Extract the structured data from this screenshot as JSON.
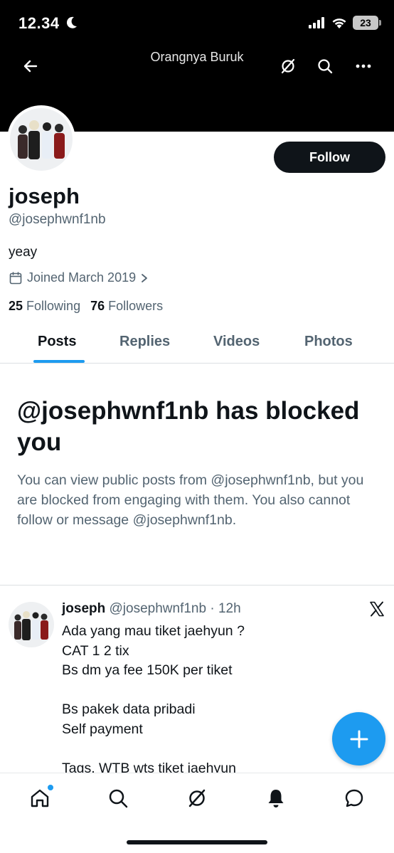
{
  "status_bar": {
    "time": "12.34",
    "battery": "23"
  },
  "header": {
    "title": "Orangnya Buruk"
  },
  "profile": {
    "display_name": "joseph",
    "handle": "@josephwnf1nb",
    "bio": "yeay",
    "joined": "Joined March 2019",
    "following_count": "25",
    "following_label": "Following",
    "followers_count": "76",
    "followers_label": "Followers",
    "follow_button": "Follow"
  },
  "tabs": [
    {
      "label": "Posts",
      "active": true
    },
    {
      "label": "Replies",
      "active": false
    },
    {
      "label": "Videos",
      "active": false
    },
    {
      "label": "Photos",
      "active": false
    }
  ],
  "blocked": {
    "title": "@josephwnf1nb has blocked you",
    "message": "You can view public posts from @josephwnf1nb, but you are blocked from engaging with them. You also cannot follow or message @josephwnf1nb."
  },
  "post": {
    "name": "joseph",
    "meta": "@josephwnf1nb · 12h",
    "text": "Ada yang mau tiket jaehyun ?\nCAT 1 2 tix\nBs dm ya fee 150K per tiket\n\nBs pakek data pribadi\nSelf payment\n\nTags. WTB wts tiket jaehyun"
  },
  "bottom_nav": [
    "home-icon",
    "search-icon",
    "grok-icon",
    "notifications-icon",
    "messages-icon"
  ],
  "colors": {
    "accent": "#1d9bf0",
    "text": "#0f1419",
    "secondary": "#536471"
  }
}
